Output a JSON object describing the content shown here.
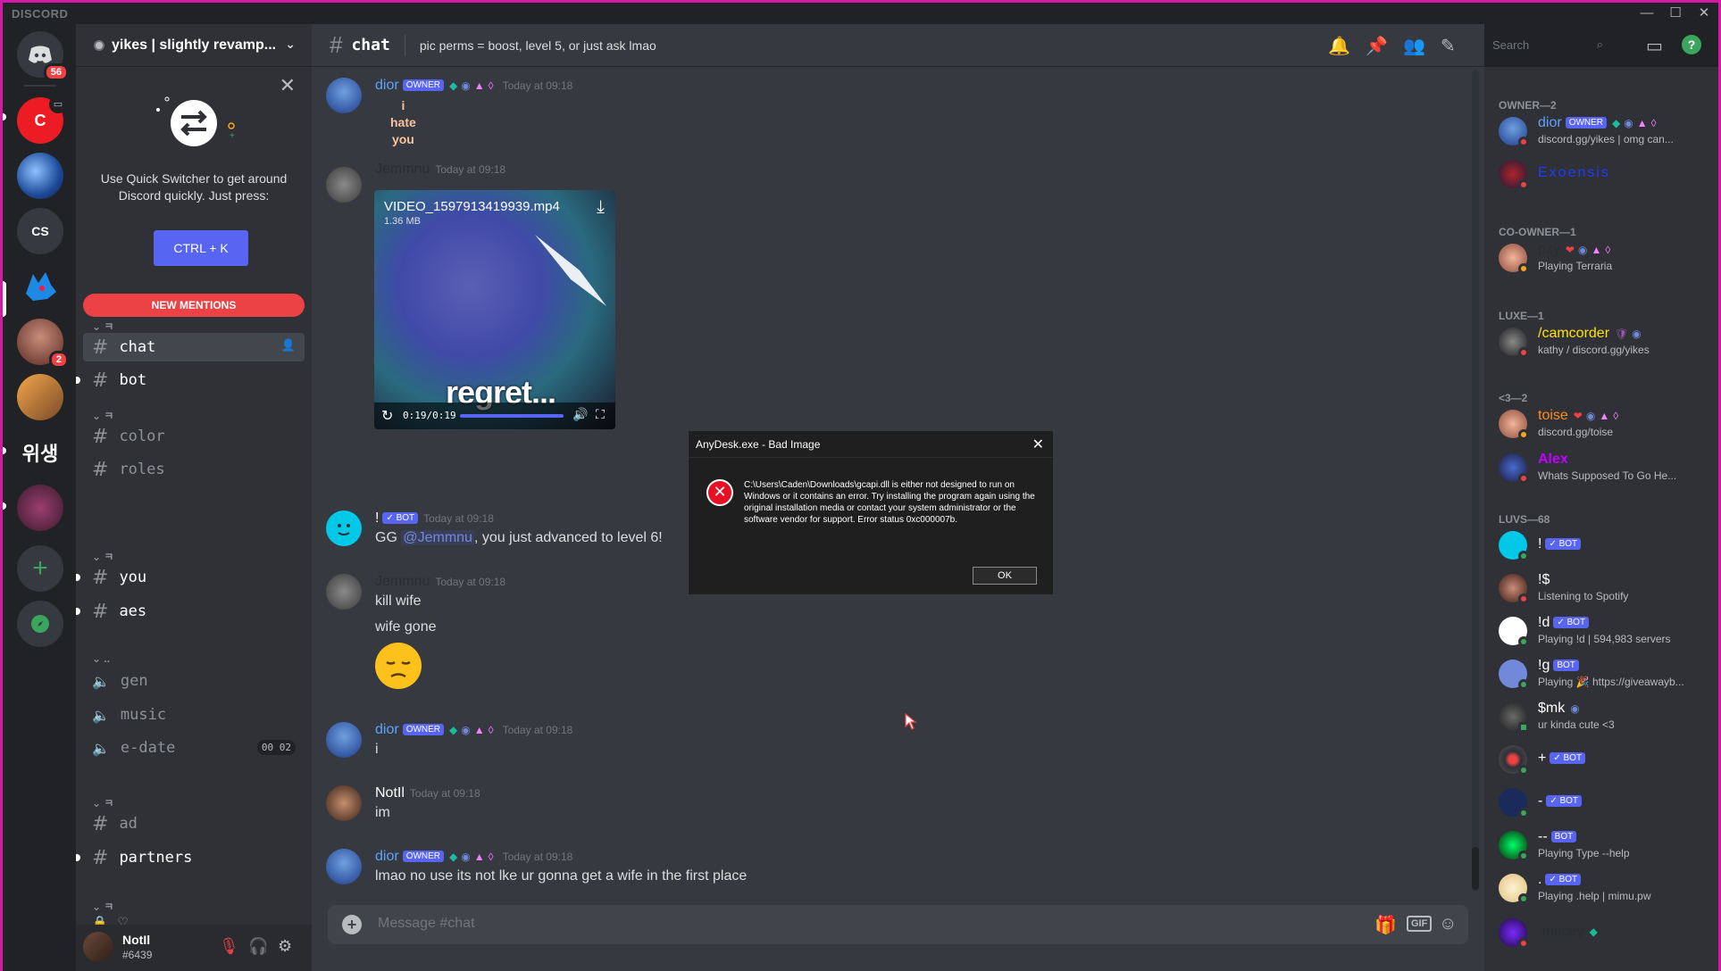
{
  "app": {
    "brand": "DISCORD"
  },
  "window": {
    "minimize": "—",
    "maximize": "☐",
    "close": "✕"
  },
  "servers": {
    "home_badge": "56",
    "c_label": "C",
    "cs_label": "CS",
    "korean_label": "위생",
    "badge_2": "2"
  },
  "guild": {
    "name": "yikes | slightly revamp..."
  },
  "quick_switcher": {
    "text": "Use Quick Switcher to get around Discord quickly. Just press:",
    "shortcut": "CTRL + K"
  },
  "new_mentions": "NEW MENTIONS",
  "channels": {
    "chat": "chat",
    "bot": "bot",
    "color": "color",
    "roles": "roles",
    "you": "you",
    "aes": "aes",
    "gen": "gen",
    "music": "music",
    "edate": "e-date",
    "edate_count": "00",
    "edate_max": "02",
    "ad": "ad",
    "partners": "partners",
    "heart": "♡"
  },
  "user": {
    "name": "NotIl",
    "tag": "#6439"
  },
  "chat": {
    "title": "chat",
    "topic": "pic perms = boost, level 5, or just ask lmao",
    "search_placeholder": "Search",
    "composer_placeholder": "Message #chat",
    "gif_label": "GIF"
  },
  "messages": {
    "m1": {
      "author": "dior",
      "tag": "OWNER",
      "time": "Today at 09:18",
      "lines": [
        "i",
        "hate",
        "you"
      ]
    },
    "m2": {
      "author": "Jemmnu",
      "time": "Today at 09:18"
    },
    "video": {
      "title": "VIDEO_1597913419939.mp4",
      "size": "1.36 MB",
      "caption": "regret...",
      "time": "0:19/0:19"
    },
    "m3": {
      "author": "!",
      "tag": "✓ BOT",
      "time": "Today at 09:18",
      "pre": "GG ",
      "mention": "@Jemmnu",
      "post": ", you just advanced to level 6!"
    },
    "m4": {
      "author": "Jemmnu",
      "time": "Today at 09:18",
      "line1": "kill wife",
      "line2": "wife gone"
    },
    "m5": {
      "author": "dior",
      "tag": "OWNER",
      "time": "Today at 09:18",
      "text": "i"
    },
    "m6": {
      "author": "NotIl",
      "time": "Today at 09:18",
      "text": "im"
    },
    "m7": {
      "author": "dior",
      "tag": "OWNER",
      "time": "Today at 09:18",
      "text": "lmao no use its not lke ur gonna get a wife in the first place"
    }
  },
  "member_list": {
    "cat_owner": "OWNER—2",
    "cat_coowner": "CO-OWNER—1",
    "cat_luxe": "LUXE—1",
    "cat_3": "<3—2",
    "cat_luvs": "LUVS—68",
    "members": [
      {
        "name": "dior",
        "tag": "OWNER",
        "sub": "discord.gg/yikes | omg can..."
      },
      {
        "name": "Exoensis",
        "sub": ""
      },
      {
        "name": "pzy",
        "sub": "Playing Terraria"
      },
      {
        "name": "/camcorder",
        "sub": "kathy / discord.gg/yikes"
      },
      {
        "name": "toise",
        "sub": "discord.gg/toise"
      },
      {
        "name": "Alex",
        "sub": "Whats Supposed To Go He..."
      },
      {
        "name": "!",
        "tag": "✓ BOT",
        "sub": ""
      },
      {
        "name": "!$",
        "sub": "Listening to Spotify"
      },
      {
        "name": "!d",
        "tag": "✓ BOT",
        "sub": "Playing !d | 594,983 servers"
      },
      {
        "name": "!g",
        "tag": "BOT",
        "sub": "Playing 🎉 https://giveawayb..."
      },
      {
        "name": "$mk",
        "sub": "ur kinda cute <3"
      },
      {
        "name": "+",
        "tag": "✓ BOT",
        "sub": ""
      },
      {
        "name": "-",
        "tag": "✓ BOT",
        "sub": ""
      },
      {
        "name": "--",
        "tag": "BOT",
        "sub": "Playing Type --help"
      },
      {
        "name": ".",
        "tag": "✓ BOT",
        "sub": "Playing .help | mimu.pw"
      },
      {
        "name": ".macey",
        "sub": ""
      }
    ]
  },
  "dialog": {
    "title": "AnyDesk.exe - Bad Image",
    "message": "C:\\Users\\Caden\\Downloads\\gcapi.dll is either not designed to run on Windows or it contains an error. Try installing the program again using the original installation media or contact your system administrator or the software vendor for support. Error status 0xc000007b.",
    "ok": "OK"
  },
  "colors": {
    "accent": "#5865f2",
    "danger": "#ed4245",
    "online": "#3ba55d",
    "dnd": "#ed4245",
    "idle": "#faa81a"
  }
}
